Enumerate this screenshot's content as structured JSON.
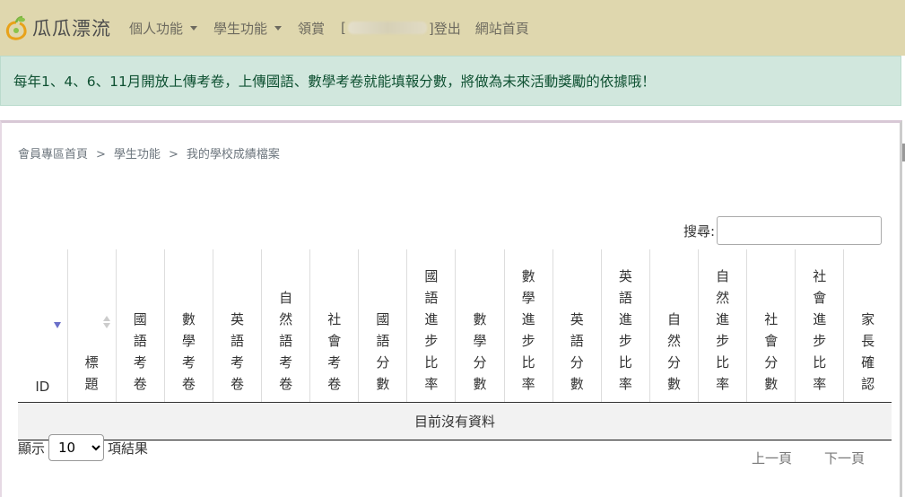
{
  "navbar": {
    "brand": "瓜瓜漂流",
    "menu": [
      {
        "label": "個人功能",
        "dropdown": true
      },
      {
        "label": "學生功能",
        "dropdown": true
      },
      {
        "label": "領賞",
        "dropdown": false
      }
    ],
    "login_prefix": "[",
    "username": "student0001",
    "login_suffix": "]登出",
    "home_link": "網站首頁"
  },
  "alert": {
    "text": "每年1、4、6、11月開放上傳考卷，上傳國語、數學考卷就能填報分數，將做為未來活動獎勵的依據哦！"
  },
  "breadcrumb": [
    "會員專區首頁",
    ">",
    "學生功能",
    ">",
    "我的學校成績檔案"
  ],
  "search": {
    "label": "搜尋:",
    "value": ""
  },
  "table": {
    "columns": [
      "ID",
      "標題",
      "國語考卷",
      "數學考卷",
      "英語考卷",
      "自然語考卷",
      "社會考卷",
      "國語分數",
      "國語進步比率",
      "數學分數",
      "數學進步比率",
      "英語分數",
      "英語進步比率",
      "自然分數",
      "自然進步比率",
      "社會分數",
      "社會進步比率",
      "家長確認"
    ],
    "empty_message": "目前沒有資料"
  },
  "length_menu": {
    "prefix": "顯示",
    "selected": "10",
    "options": [
      "10"
    ],
    "suffix": "項結果"
  },
  "pager": {
    "prev": "上一頁",
    "next": "下一頁"
  },
  "colors": {
    "navbar_bg": "#dfd7ae",
    "alert_bg": "#d1e7dd",
    "alert_text": "#0f5132",
    "sort_active": "#6a6fc9"
  }
}
